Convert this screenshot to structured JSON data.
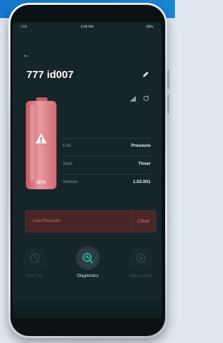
{
  "status_bar": {
    "carrier": "LTE",
    "time": "2:48 PM",
    "battery": "80%"
  },
  "device": {
    "title": "777 id007"
  },
  "battery_level": {
    "label": "80%",
    "fraction": 0.8,
    "color": "#d46f77"
  },
  "info": [
    {
      "key": "End",
      "value": "Pressure"
    },
    {
      "key": "Start",
      "value": "Timer"
    },
    {
      "key": "Version",
      "value": "1.02.001"
    }
  ],
  "alert": {
    "message": "Low Pressure",
    "action": "Clear"
  },
  "actions": [
    {
      "label": "Run Test",
      "icon": "run-test-icon",
      "enabled": false
    },
    {
      "label": "Diagnostics",
      "icon": "diagnostics-icon",
      "enabled": true
    },
    {
      "label": "Manual Run",
      "icon": "manual-run-icon",
      "enabled": false
    }
  ],
  "icons": {
    "back": "back-arrow-icon",
    "edit": "pencil-icon",
    "signal": "signal-icon",
    "sync": "sync-icon",
    "warning": "warning-icon"
  },
  "colors": {
    "accent": "#d46f77",
    "background": "#15252a",
    "alert_bg": "#4a2528"
  }
}
